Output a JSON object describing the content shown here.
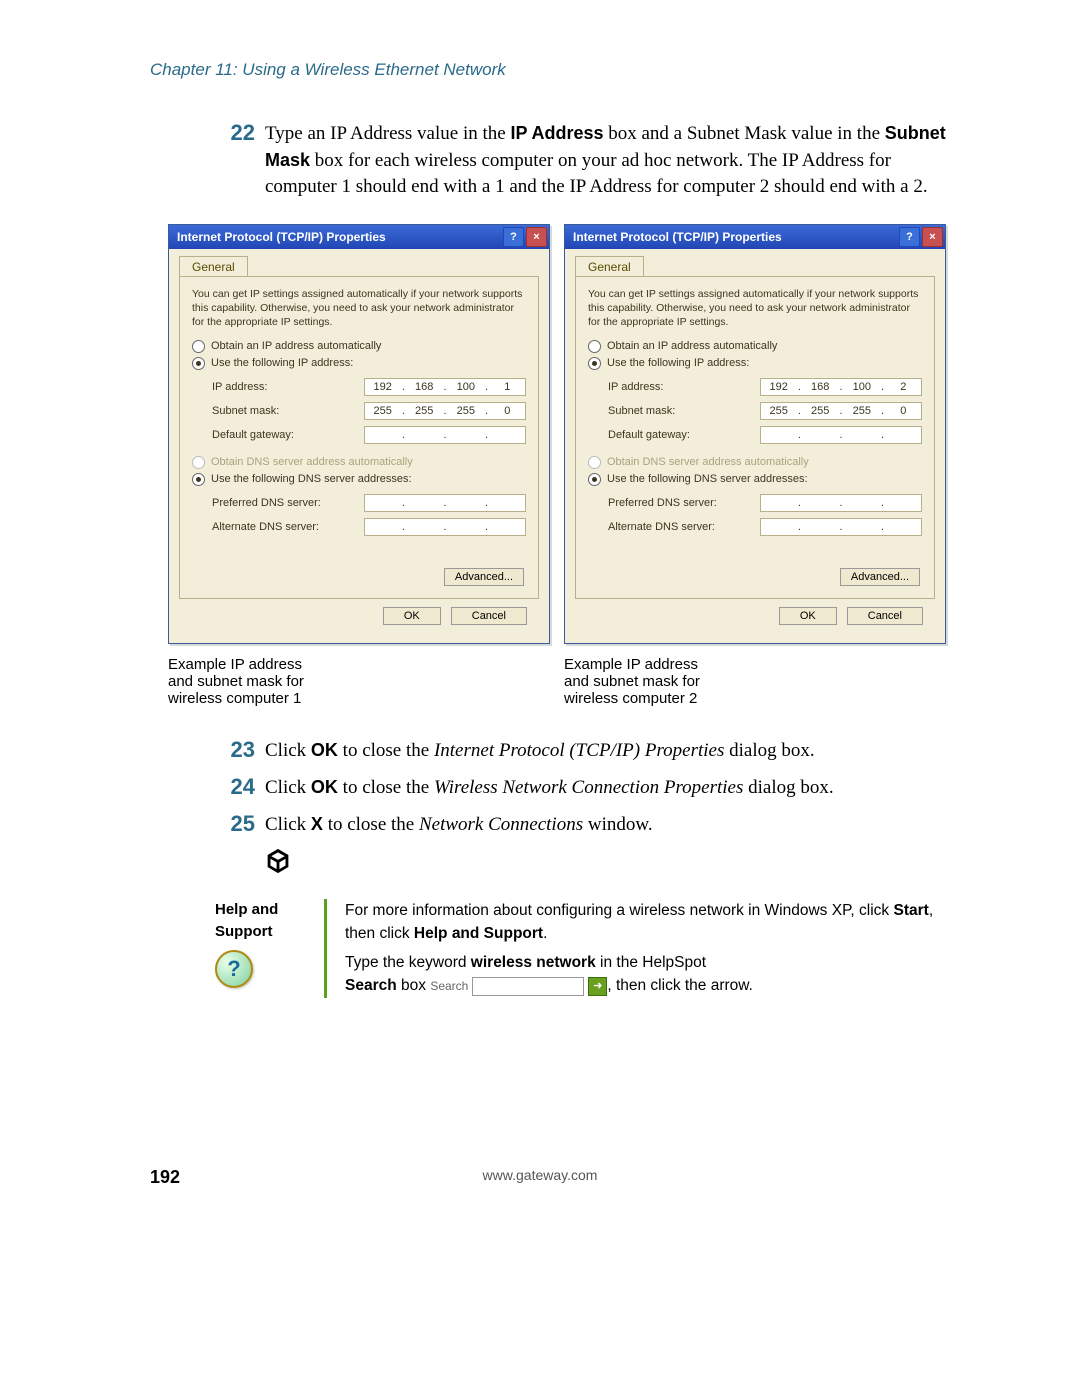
{
  "chapter_header": "Chapter 11: Using a Wireless Ethernet Network",
  "step22": {
    "number": "22",
    "text_pre": "Type an IP Address value in the ",
    "bold1": "IP Address",
    "text_mid1": " box and a Subnet Mask value in the ",
    "bold2": "Subnet Mask",
    "text_after": " box for each wireless computer on your ad hoc network. The IP Address for computer 1 should end with a 1 and the IP Address for computer 2 should end with a 2."
  },
  "dialog": {
    "title": "Internet Protocol (TCP/IP) Properties",
    "help_btn": "?",
    "close_btn": "×",
    "tab": "General",
    "desc": "You can get IP settings assigned automatically if your network supports this capability. Otherwise, you need to ask your network administrator for the appropriate IP settings.",
    "radio_auto_ip": "Obtain an IP address automatically",
    "radio_manual_ip": "Use the following IP address:",
    "ip_label": "IP address:",
    "subnet_label": "Subnet mask:",
    "gateway_label": "Default gateway:",
    "radio_auto_dns": "Obtain DNS server address automatically",
    "radio_manual_dns": "Use the following DNS server addresses:",
    "pref_dns_label": "Preferred DNS server:",
    "alt_dns_label": "Alternate DNS server:",
    "advanced_btn": "Advanced...",
    "ok_btn": "OK",
    "cancel_btn": "Cancel"
  },
  "computer1": {
    "ip": [
      "192",
      "168",
      "100",
      "1"
    ],
    "subnet": [
      "255",
      "255",
      "255",
      "0"
    ],
    "caption_l1": "Example IP address",
    "caption_l2": "and subnet mask for",
    "caption_l3": "wireless computer 1"
  },
  "computer2": {
    "ip": [
      "192",
      "168",
      "100",
      "2"
    ],
    "subnet": [
      "255",
      "255",
      "255",
      "0"
    ],
    "caption_l1": "Example IP address",
    "caption_l2": "and subnet mask for",
    "caption_l3": "wireless computer 2"
  },
  "step23": {
    "number": "23",
    "pre": "Click ",
    "bold": "OK",
    "mid": " to close the ",
    "ital": "Internet Protocol (TCP/IP) Properties",
    "after": " dialog box."
  },
  "step24": {
    "number": "24",
    "pre": "Click ",
    "bold": "OK",
    "mid": " to close the ",
    "ital": "Wireless Network Connection Properties",
    "after": " dialog box."
  },
  "step25": {
    "number": "25",
    "pre": "Click ",
    "bold": "X",
    "mid": " to close the ",
    "ital": "Network Connections",
    "after": " window."
  },
  "help": {
    "left_l1": "Help and",
    "left_l2": "Support",
    "right_p1_pre": "For more information about configuring a wireless network in Windows XP, click ",
    "right_p1_b1": "Start",
    "right_p1_mid": ", then click ",
    "right_p1_b2": "Help and Support",
    "right_p1_after": ".",
    "right_p2_pre": "Type the keyword ",
    "right_p2_b1": "wireless network",
    "right_p2_mid": " in the HelpSpot ",
    "right_p2_b2": "Search",
    "right_p2_after_box_label": " box ",
    "search_label": "Search",
    "right_p2_end": ", then click the arrow."
  },
  "footer": {
    "page": "192",
    "url": "www.gateway.com"
  }
}
